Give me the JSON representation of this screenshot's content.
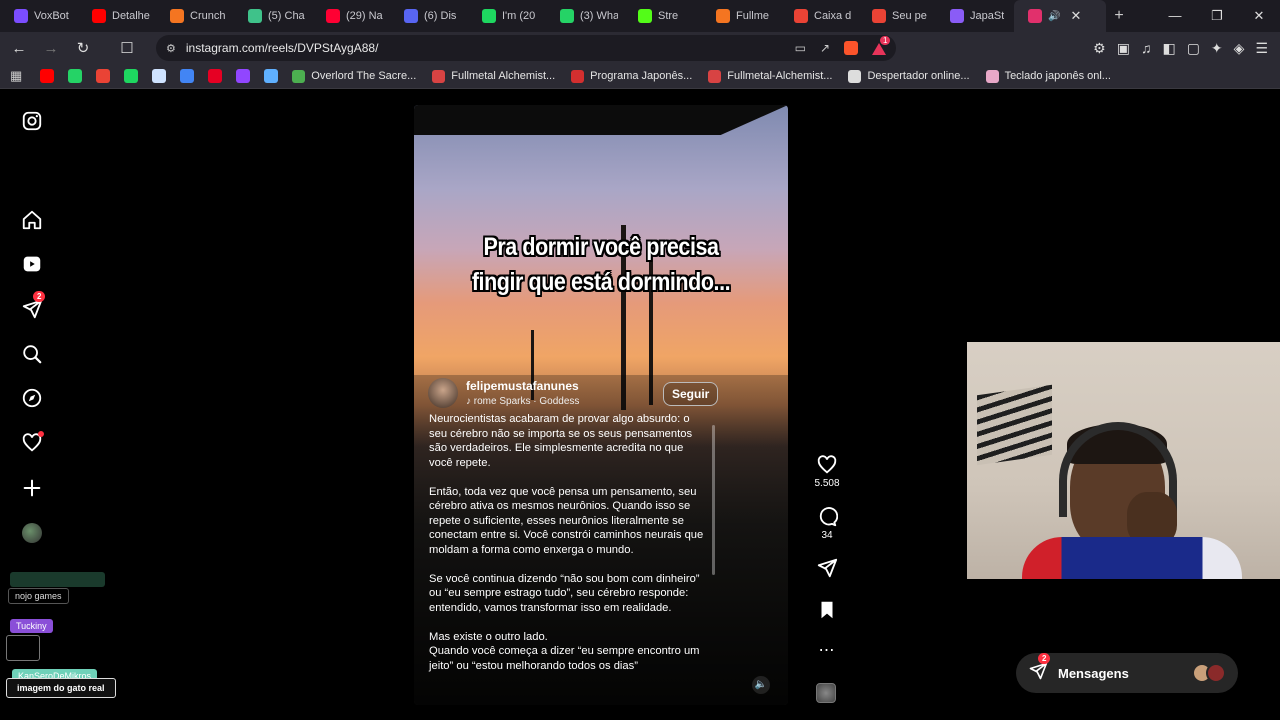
{
  "tabs": [
    {
      "title": "VoxBot",
      "color": "#7b4dff"
    },
    {
      "title": "Detalhe",
      "color": "#ff0000"
    },
    {
      "title": "Crunch",
      "color": "#f47521"
    },
    {
      "title": "(5) Cha",
      "color": "#3fc28a"
    },
    {
      "title": "(29) Na",
      "color": "#ff0033"
    },
    {
      "title": "(6) Dis",
      "color": "#5865f2"
    },
    {
      "title": "I'm (20",
      "color": "#1ed760"
    },
    {
      "title": "(3) Wha",
      "color": "#25d366"
    },
    {
      "title": "Stre",
      "color": "#53fc18"
    },
    {
      "title": "Fullme",
      "color": "#f47521"
    },
    {
      "title": "Caixa d",
      "color": "#ea4335"
    },
    {
      "title": "Seu pe",
      "color": "#ea4335"
    },
    {
      "title": "JapaSt",
      "color": "#8a5cf6"
    }
  ],
  "active_tab": {
    "icon": "instagram-icon",
    "color": "#e1306c"
  },
  "address_bar": {
    "url": "instagram.com/reels/DVPStAygA88/",
    "rewards_count": "1"
  },
  "bookmarks": [
    {
      "title": "Overlord The Sacre...",
      "color": "#4caf50"
    },
    {
      "title": "Fullmetal Alchemist...",
      "color": "#d84343"
    },
    {
      "title": "Programa Japonês...",
      "color": "#d32f2f"
    },
    {
      "title": "Fullmetal-Alchemist...",
      "color": "#d84343"
    },
    {
      "title": "Despertador online...",
      "color": "#dddddd"
    },
    {
      "title": "Teclado japonês onl...",
      "color": "#e8a8c8"
    }
  ],
  "bookmark_icons": [
    "#ff0000",
    "#25d366",
    "#ea4335",
    "#1ed760",
    "#cfe3ff",
    "#4285f4",
    "#e60023",
    "#9146ff",
    "#5fb0ff"
  ],
  "sidenav": {
    "notifications_badge": "2"
  },
  "overlays": {
    "tag1": "nojo games",
    "tag2": "Tuckiny",
    "tag3": "KanSeroDeMikros",
    "tag4": "imagem do gato real"
  },
  "reel": {
    "caption_line1": "Pra dormir você precisa",
    "caption_line2": "fingir que está dormindo...",
    "author": "felipemustafanunes",
    "music": "rome Sparks · Goddess",
    "follow_label": "Seguir",
    "description": [
      "Neurocientistas acabaram de provar algo absurdo: o seu cérebro não se importa se os seus pensamentos são verdadeiros. Ele simplesmente acredita no que você repete.",
      "Então, toda vez que você pensa um pensamento, seu cérebro ativa os mesmos neurônios. Quando isso se repete o suficiente, esses neurônios literalmente se conectam entre si. Você constrói caminhos neurais que moldam a forma como enxerga o mundo.",
      "Se você continua dizendo “não sou bom com dinheiro” ou “eu sempre estrago tudo”, seu cérebro responde: entendido, vamos transformar isso em realidade.",
      "Mas existe o outro lado.\nQuando você começa a dizer “eu sempre encontro um jeito” ou “estou melhorando todos os dias”"
    ]
  },
  "actions": {
    "likes": "5.508",
    "comments": "34"
  },
  "messages": {
    "label": "Mensagens",
    "badge": "2"
  }
}
